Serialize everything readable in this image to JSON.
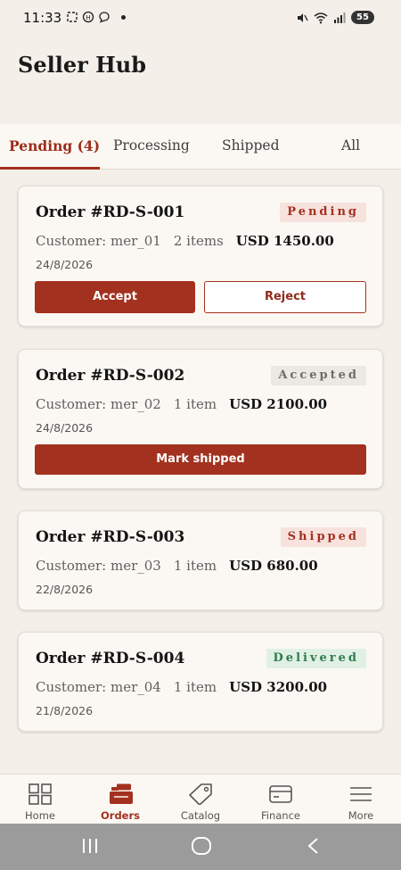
{
  "status_bar": {
    "time": "11:33",
    "battery": "55"
  },
  "header": {
    "title": "Seller Hub"
  },
  "tabs": [
    {
      "label": "Pending (4)",
      "active": true
    },
    {
      "label": "Processing",
      "active": false
    },
    {
      "label": "Shipped",
      "active": false
    },
    {
      "label": "All",
      "active": false
    }
  ],
  "orders": [
    {
      "id": "Order #RD-S-001",
      "status": "Pending",
      "customer": "Customer: mer_01",
      "items": "2 items",
      "amount": "USD 1450.00",
      "date": "24/8/2026",
      "actions": [
        "Accept",
        "Reject"
      ]
    },
    {
      "id": "Order #RD-S-002",
      "status": "Accepted",
      "customer": "Customer: mer_02",
      "items": "1 item",
      "amount": "USD 2100.00",
      "date": "24/8/2026",
      "actions": [
        "Mark shipped"
      ]
    },
    {
      "id": "Order #RD-S-003",
      "status": "Shipped",
      "customer": "Customer: mer_03",
      "items": "1 item",
      "amount": "USD 680.00",
      "date": "22/8/2026",
      "actions": []
    },
    {
      "id": "Order #RD-S-004",
      "status": "Delivered",
      "customer": "Customer: mer_04",
      "items": "1 item",
      "amount": "USD 3200.00",
      "date": "21/8/2026",
      "actions": []
    }
  ],
  "bottom_nav": [
    {
      "label": "Home",
      "icon": "grid-icon",
      "active": false
    },
    {
      "label": "Orders",
      "icon": "orders-icon",
      "active": true
    },
    {
      "label": "Catalog",
      "icon": "tag-icon",
      "active": false
    },
    {
      "label": "Finance",
      "icon": "card-icon",
      "active": false
    },
    {
      "label": "More",
      "icon": "menu-icon",
      "active": false
    }
  ],
  "colors": {
    "accent": "#a3311f",
    "background": "#f4f0e9",
    "surface": "#fbf8f3",
    "delivered": "#2e7d4c"
  }
}
